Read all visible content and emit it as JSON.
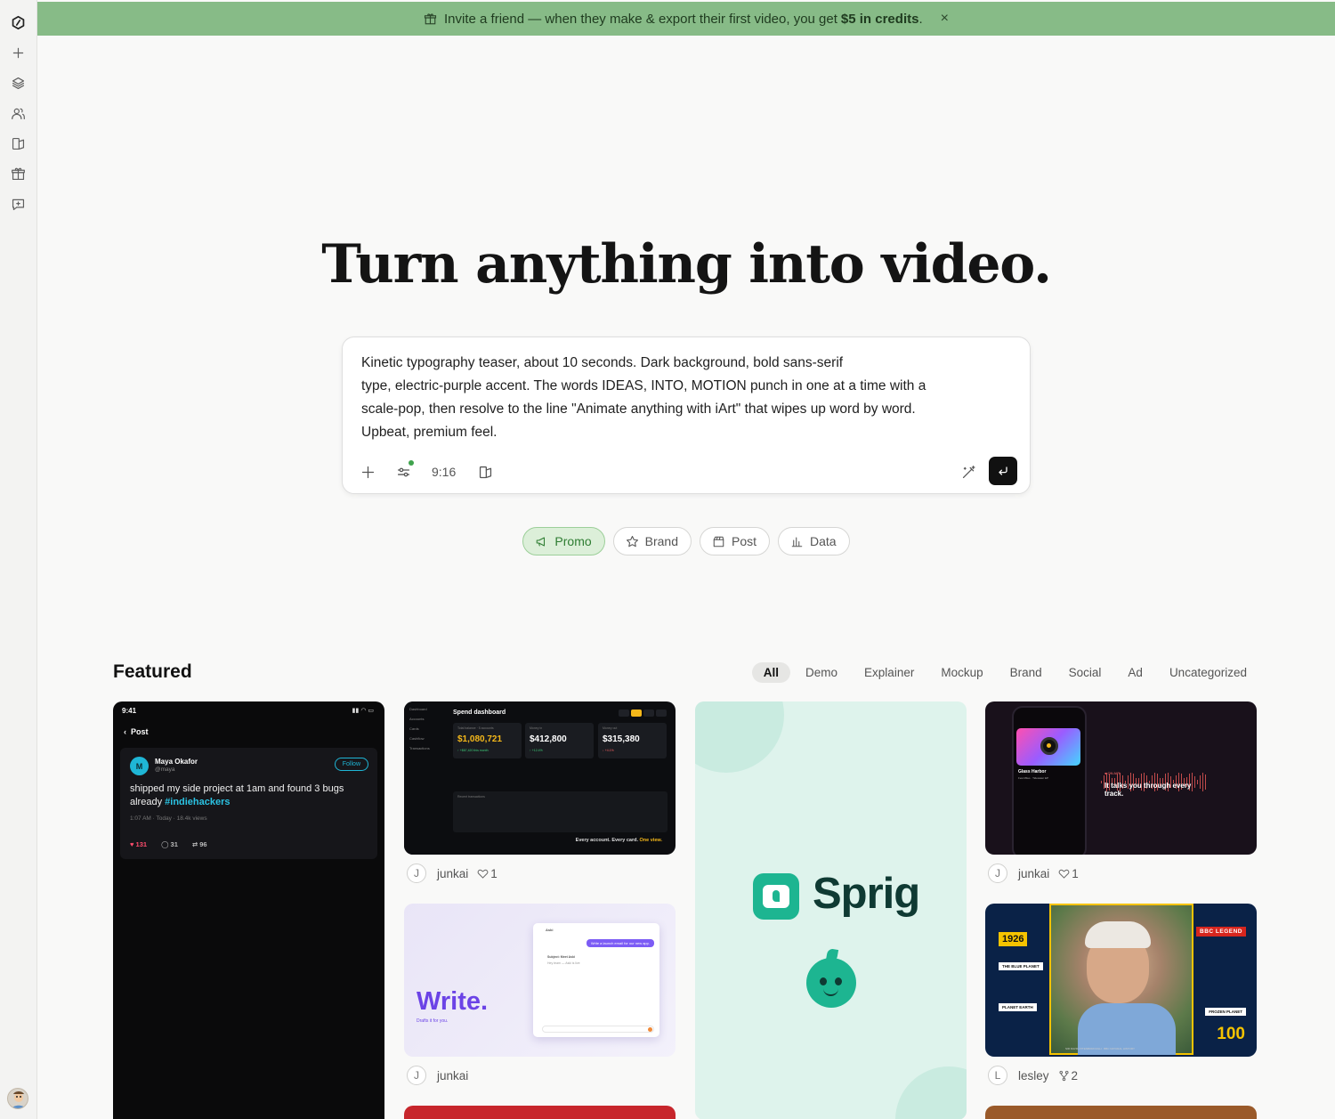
{
  "sidebar": {
    "items": [
      {
        "name": "logo-icon"
      },
      {
        "name": "new-project-icon"
      },
      {
        "name": "layers-icon"
      },
      {
        "name": "users-icon"
      },
      {
        "name": "templates-icon"
      },
      {
        "name": "gift-icon"
      },
      {
        "name": "feedback-icon"
      }
    ]
  },
  "banner": {
    "text": "Invite a friend — when they make & export their first video, you get",
    "highlight": "$5 in credits",
    "suffix": ".",
    "close": "×"
  },
  "hero": {
    "title": "Turn anything into video."
  },
  "prompt": {
    "text": "Kinetic typography teaser, about 10 seconds. Dark background, bold sans-serif\n type, electric-purple accent. The words IDEAS, INTO, MOTION punch in one at a time with a\n scale-pop, then resolve to the line \"Animate anything with iArt\" that wipes up word by word.\n Upbeat, premium feel.",
    "aspect": "9:16"
  },
  "chips": [
    {
      "label": "Promo",
      "icon": "megaphone-icon",
      "active": true
    },
    {
      "label": "Brand",
      "icon": "star-icon",
      "active": false
    },
    {
      "label": "Post",
      "icon": "clapperboard-icon",
      "active": false
    },
    {
      "label": "Data",
      "icon": "bar-chart-icon",
      "active": false
    }
  ],
  "featured": {
    "title": "Featured",
    "filters": [
      "All",
      "Demo",
      "Explainer",
      "Mockup",
      "Brand",
      "Social",
      "Ad",
      "Uncategorized"
    ],
    "active_filter": "All"
  },
  "cards": {
    "post": {
      "time": "9:41",
      "back": "Post",
      "avatar": "M",
      "name": "Maya Okafor",
      "handle": "@maya",
      "follow": "Follow",
      "body": "shipped my side project at 1am and found 3 bugs already",
      "tag": "#indiehackers",
      "meta": "1:07 AM · Today · 18.4k views",
      "likes": "131",
      "replies": "31",
      "reposts": "96"
    },
    "dashboard": {
      "title": "Spend dashboard",
      "sidebar": [
        "Dashboard",
        "Accounts",
        "Cards",
        "Cashflow",
        "Transactions"
      ],
      "metrics": [
        {
          "label": "Total balance · 5 accounts",
          "value": "$1,080,721",
          "sub": "↑ +$67,420 this month",
          "color": "#f5b81a",
          "subcolor": "#3fcf7a"
        },
        {
          "label": "Money in",
          "value": "$412,800",
          "sub": "↑ +12.4%",
          "color": "#ffffff",
          "subcolor": "#3fcf7a"
        },
        {
          "label": "Money out",
          "value": "$315,380",
          "sub": "↓ +4.1%",
          "color": "#ffffff",
          "subcolor": "#ff6464"
        }
      ],
      "panel_label": "Recent transactions",
      "footer": "Every account. Every card.",
      "footer_highlight": "One view.",
      "author_initial": "J",
      "author": "junkai",
      "likes": "1"
    },
    "write": {
      "word": "Write.",
      "sub": "Drafts it for you.",
      "app": "Aski",
      "bubble": "Write a launch email for our new app.",
      "line1": "Subject: Meet Aski",
      "line2": "Hey team — Aski is live",
      "author_initial": "J",
      "author": "junkai"
    },
    "sprig": {
      "brand": "Sprig"
    },
    "music": {
      "track": "Glass Harbor",
      "small": "Few Miles · Tidewater EP",
      "onair": "● ON AIR",
      "title": "It talks you through every track.",
      "author_initial": "J",
      "author": "junkai",
      "likes": "1"
    },
    "bbc": {
      "year": "1926",
      "label1": "THE BLUE PLANET",
      "label2": "PLANET EARTH",
      "legend": "BBC LEGEND",
      "label3": "FROZEN PLANET",
      "num": "100",
      "bottom": "SIR DAVID ATTENBOROUGH · BBC NATURAL HISTORY",
      "author_initial": "L",
      "author": "lesley",
      "remixes": "2"
    }
  },
  "colors": {
    "banner": "#87bb87",
    "accent_green": "#2e7d32",
    "submit": "#111111"
  }
}
